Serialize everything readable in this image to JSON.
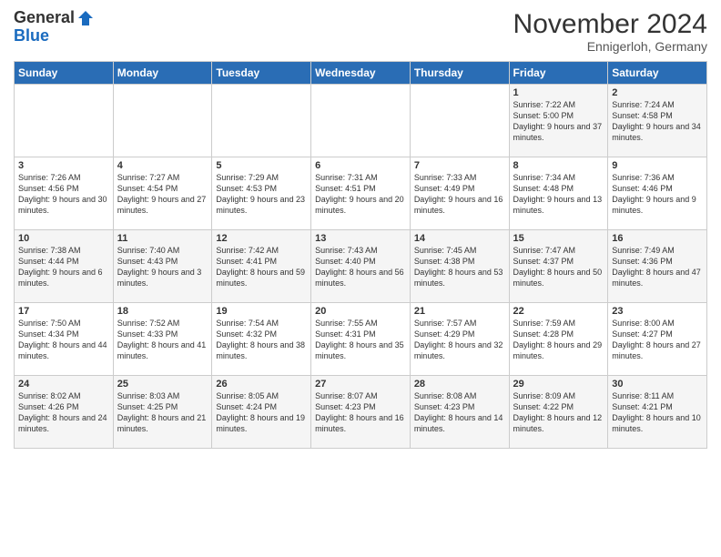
{
  "logo": {
    "general": "General",
    "blue": "Blue"
  },
  "header": {
    "month": "November 2024",
    "location": "Ennigerloh, Germany"
  },
  "days_of_week": [
    "Sunday",
    "Monday",
    "Tuesday",
    "Wednesday",
    "Thursday",
    "Friday",
    "Saturday"
  ],
  "weeks": [
    [
      {
        "num": "",
        "info": ""
      },
      {
        "num": "",
        "info": ""
      },
      {
        "num": "",
        "info": ""
      },
      {
        "num": "",
        "info": ""
      },
      {
        "num": "",
        "info": ""
      },
      {
        "num": "1",
        "info": "Sunrise: 7:22 AM\nSunset: 5:00 PM\nDaylight: 9 hours and 37 minutes."
      },
      {
        "num": "2",
        "info": "Sunrise: 7:24 AM\nSunset: 4:58 PM\nDaylight: 9 hours and 34 minutes."
      }
    ],
    [
      {
        "num": "3",
        "info": "Sunrise: 7:26 AM\nSunset: 4:56 PM\nDaylight: 9 hours and 30 minutes."
      },
      {
        "num": "4",
        "info": "Sunrise: 7:27 AM\nSunset: 4:54 PM\nDaylight: 9 hours and 27 minutes."
      },
      {
        "num": "5",
        "info": "Sunrise: 7:29 AM\nSunset: 4:53 PM\nDaylight: 9 hours and 23 minutes."
      },
      {
        "num": "6",
        "info": "Sunrise: 7:31 AM\nSunset: 4:51 PM\nDaylight: 9 hours and 20 minutes."
      },
      {
        "num": "7",
        "info": "Sunrise: 7:33 AM\nSunset: 4:49 PM\nDaylight: 9 hours and 16 minutes."
      },
      {
        "num": "8",
        "info": "Sunrise: 7:34 AM\nSunset: 4:48 PM\nDaylight: 9 hours and 13 minutes."
      },
      {
        "num": "9",
        "info": "Sunrise: 7:36 AM\nSunset: 4:46 PM\nDaylight: 9 hours and 9 minutes."
      }
    ],
    [
      {
        "num": "10",
        "info": "Sunrise: 7:38 AM\nSunset: 4:44 PM\nDaylight: 9 hours and 6 minutes."
      },
      {
        "num": "11",
        "info": "Sunrise: 7:40 AM\nSunset: 4:43 PM\nDaylight: 9 hours and 3 minutes."
      },
      {
        "num": "12",
        "info": "Sunrise: 7:42 AM\nSunset: 4:41 PM\nDaylight: 8 hours and 59 minutes."
      },
      {
        "num": "13",
        "info": "Sunrise: 7:43 AM\nSunset: 4:40 PM\nDaylight: 8 hours and 56 minutes."
      },
      {
        "num": "14",
        "info": "Sunrise: 7:45 AM\nSunset: 4:38 PM\nDaylight: 8 hours and 53 minutes."
      },
      {
        "num": "15",
        "info": "Sunrise: 7:47 AM\nSunset: 4:37 PM\nDaylight: 8 hours and 50 minutes."
      },
      {
        "num": "16",
        "info": "Sunrise: 7:49 AM\nSunset: 4:36 PM\nDaylight: 8 hours and 47 minutes."
      }
    ],
    [
      {
        "num": "17",
        "info": "Sunrise: 7:50 AM\nSunset: 4:34 PM\nDaylight: 8 hours and 44 minutes."
      },
      {
        "num": "18",
        "info": "Sunrise: 7:52 AM\nSunset: 4:33 PM\nDaylight: 8 hours and 41 minutes."
      },
      {
        "num": "19",
        "info": "Sunrise: 7:54 AM\nSunset: 4:32 PM\nDaylight: 8 hours and 38 minutes."
      },
      {
        "num": "20",
        "info": "Sunrise: 7:55 AM\nSunset: 4:31 PM\nDaylight: 8 hours and 35 minutes."
      },
      {
        "num": "21",
        "info": "Sunrise: 7:57 AM\nSunset: 4:29 PM\nDaylight: 8 hours and 32 minutes."
      },
      {
        "num": "22",
        "info": "Sunrise: 7:59 AM\nSunset: 4:28 PM\nDaylight: 8 hours and 29 minutes."
      },
      {
        "num": "23",
        "info": "Sunrise: 8:00 AM\nSunset: 4:27 PM\nDaylight: 8 hours and 27 minutes."
      }
    ],
    [
      {
        "num": "24",
        "info": "Sunrise: 8:02 AM\nSunset: 4:26 PM\nDaylight: 8 hours and 24 minutes."
      },
      {
        "num": "25",
        "info": "Sunrise: 8:03 AM\nSunset: 4:25 PM\nDaylight: 8 hours and 21 minutes."
      },
      {
        "num": "26",
        "info": "Sunrise: 8:05 AM\nSunset: 4:24 PM\nDaylight: 8 hours and 19 minutes."
      },
      {
        "num": "27",
        "info": "Sunrise: 8:07 AM\nSunset: 4:23 PM\nDaylight: 8 hours and 16 minutes."
      },
      {
        "num": "28",
        "info": "Sunrise: 8:08 AM\nSunset: 4:23 PM\nDaylight: 8 hours and 14 minutes."
      },
      {
        "num": "29",
        "info": "Sunrise: 8:09 AM\nSunset: 4:22 PM\nDaylight: 8 hours and 12 minutes."
      },
      {
        "num": "30",
        "info": "Sunrise: 8:11 AM\nSunset: 4:21 PM\nDaylight: 8 hours and 10 minutes."
      }
    ]
  ]
}
